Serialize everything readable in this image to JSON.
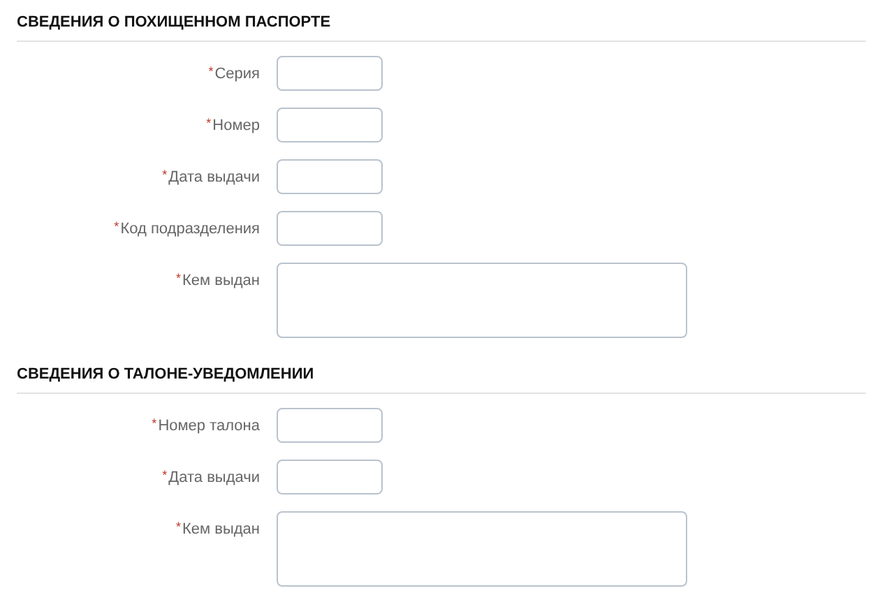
{
  "sections": [
    {
      "title": "СВЕДЕНИЯ О ПОХИЩЕННОМ ПАСПОРТЕ",
      "fields": [
        {
          "label": "Серия",
          "required_mark": "*",
          "kind": "input"
        },
        {
          "label": "Номер",
          "required_mark": "*",
          "kind": "input"
        },
        {
          "label": "Дата выдачи",
          "required_mark": "*",
          "kind": "input"
        },
        {
          "label": "Код подразделения",
          "required_mark": "*",
          "kind": "input"
        },
        {
          "label": "Кем выдан",
          "required_mark": "*",
          "kind": "textarea"
        }
      ]
    },
    {
      "title": "СВЕДЕНИЯ О ТАЛОНЕ-УВЕДОМЛЕНИИ",
      "fields": [
        {
          "label": "Номер талона",
          "required_mark": "*",
          "kind": "input"
        },
        {
          "label": "Дата выдачи",
          "required_mark": "*",
          "kind": "input"
        },
        {
          "label": "Кем выдан",
          "required_mark": "*",
          "kind": "textarea"
        }
      ]
    }
  ]
}
